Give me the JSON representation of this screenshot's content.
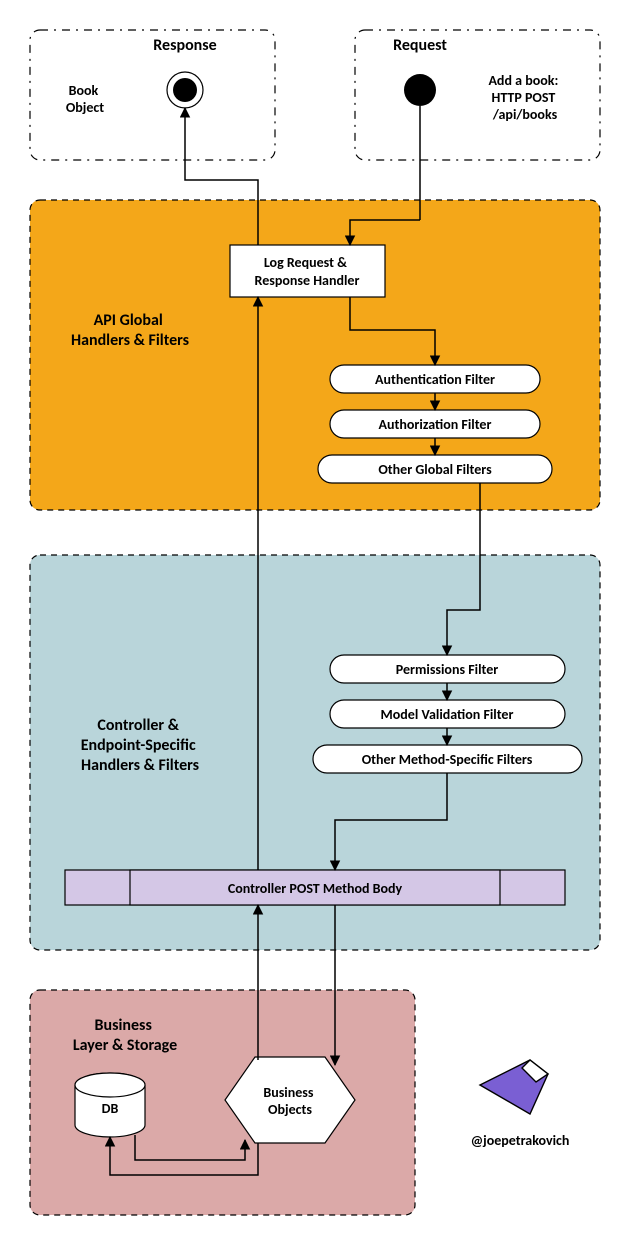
{
  "top": {
    "response_title": "Response",
    "request_title": "Request",
    "response_caption": "Book\nObject",
    "request_caption": "Add a book:\nHTTP POST\n/api/books"
  },
  "global_section": {
    "title": "API Global\nHandlers & Filters",
    "handler_box": "Log Request &\nResponse Handler",
    "filters": [
      "Authentication Filter",
      "Authorization Filter",
      "Other Global Filters"
    ]
  },
  "controller_section": {
    "title": "Controller &\nEndpoint-Specific\nHandlers & Filters",
    "filters": [
      "Permissions Filter",
      "Model Validation Filter",
      "Other Method-Specific Filters"
    ],
    "method_body": "Controller POST Method Body"
  },
  "storage_section": {
    "title": "Business\nLayer & Storage",
    "db": "DB",
    "business": "Business\nObjects"
  },
  "credit": "@joepetrakovich"
}
